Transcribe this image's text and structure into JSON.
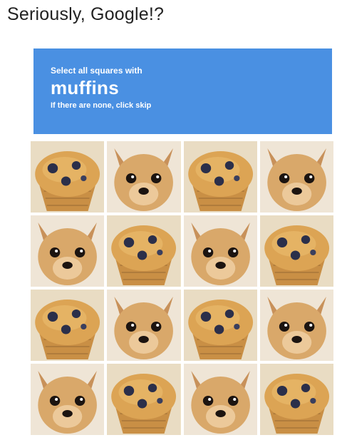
{
  "caption": "Seriously, Google!?",
  "captcha": {
    "instruction": "Select all squares with",
    "keyword": "muffins",
    "hint": "If there are none, click skip"
  },
  "colors": {
    "header_blue": "#4a90e2",
    "muffin_crust": "#d8a04a",
    "blueberry": "#2b2f4a",
    "dog_fur": "#d9a86a"
  },
  "tiles": [
    {
      "depicts": "muffin"
    },
    {
      "depicts": "chihuahua"
    },
    {
      "depicts": "muffin"
    },
    {
      "depicts": "chihuahua"
    },
    {
      "depicts": "chihuahua"
    },
    {
      "depicts": "muffin"
    },
    {
      "depicts": "chihuahua"
    },
    {
      "depicts": "muffin"
    },
    {
      "depicts": "muffin"
    },
    {
      "depicts": "chihuahua"
    },
    {
      "depicts": "muffin"
    },
    {
      "depicts": "chihuahua"
    },
    {
      "depicts": "chihuahua"
    },
    {
      "depicts": "muffin"
    },
    {
      "depicts": "chihuahua"
    },
    {
      "depicts": "muffin"
    }
  ]
}
